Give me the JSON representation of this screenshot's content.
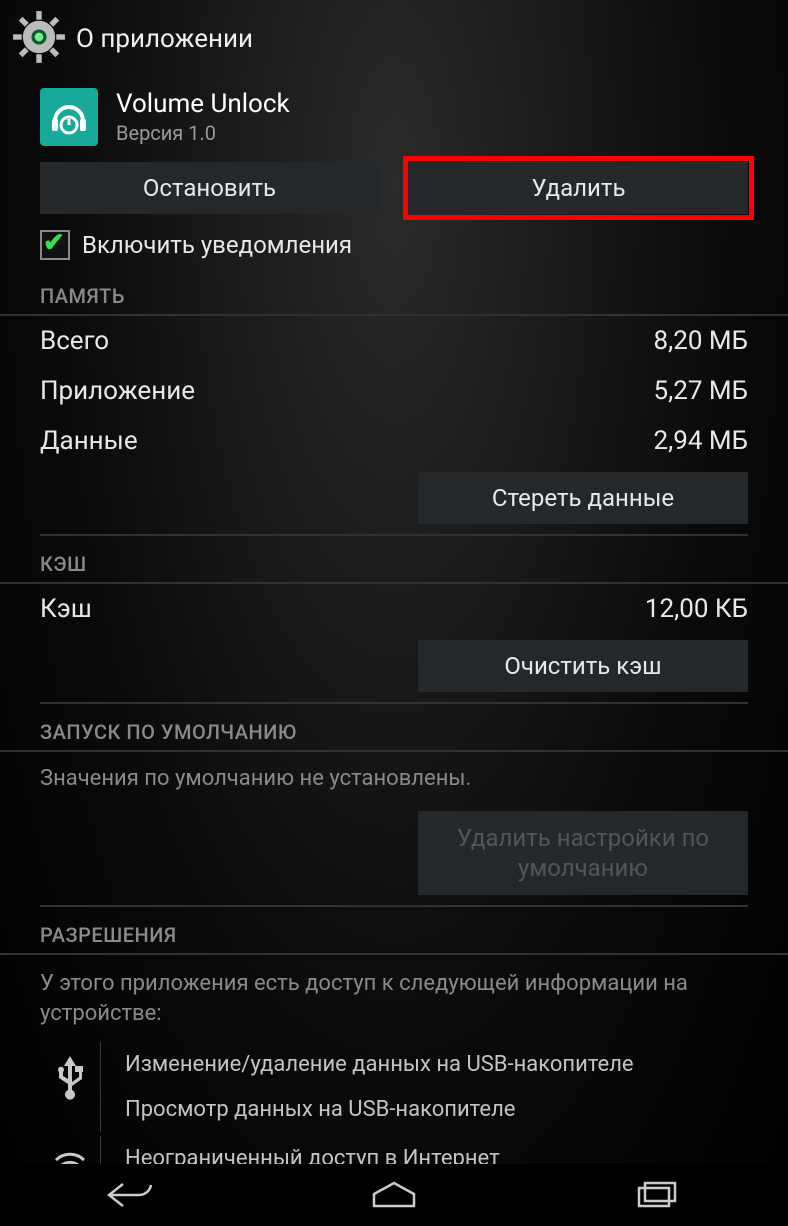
{
  "header": {
    "title": "О приложении"
  },
  "app": {
    "name": "Volume Unlock",
    "version": "Версия 1.0"
  },
  "buttons": {
    "stop": "Остановить",
    "uninstall": "Удалить"
  },
  "notifications": {
    "label": "Включить уведомления",
    "checked": true
  },
  "storage": {
    "heading": "ПАМЯТЬ",
    "total_label": "Всего",
    "total_value": "8,20 МБ",
    "app_label": "Приложение",
    "app_value": "5,27 МБ",
    "data_label": "Данные",
    "data_value": "2,94 МБ",
    "clear_data": "Стереть данные"
  },
  "cache": {
    "heading": "КЭШ",
    "label": "Кэш",
    "value": "12,00 КБ",
    "clear_cache": "Очистить кэш"
  },
  "defaults": {
    "heading": "ЗАПУСК ПО УМОЛЧАНИЮ",
    "text": "Значения по умолчанию не установлены.",
    "clear_defaults": "Удалить настройки по умолчанию"
  },
  "permissions": {
    "heading": "РАЗРЕШЕНИЯ",
    "intro": "У этого приложения есть доступ к следующей информации на устройстве:",
    "usb1": "Изменение/удаление данных на USB-накопителе",
    "usb2": "Просмотр данных на USB-накопителе",
    "net1": "Неограниченный доступ в Интернет"
  }
}
